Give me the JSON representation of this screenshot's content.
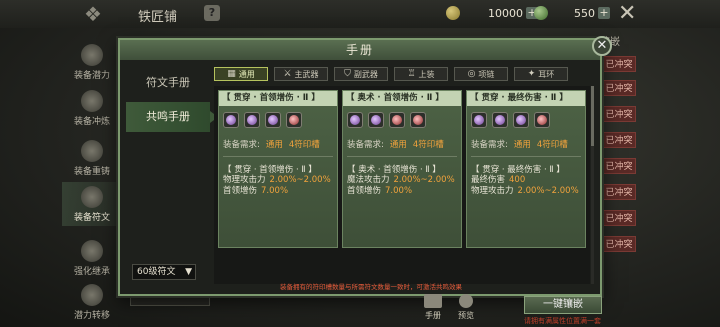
{
  "top": {
    "title": "铁匠铺",
    "resources": [
      {
        "icon": "gold-coin-icon",
        "value": "10000"
      },
      {
        "icon": "silver-coin-icon",
        "value": "550"
      }
    ]
  },
  "sidebar": {
    "items": [
      {
        "label": "装备潜力",
        "icon": "potential-icon"
      },
      {
        "label": "装备冲炼",
        "icon": "anvil-icon"
      },
      {
        "label": "装备重铸",
        "icon": "hammer-icon"
      },
      {
        "label": "装备符文",
        "icon": "rune-icon",
        "active": true
      },
      {
        "label": "强化继承",
        "icon": "inherit-icon"
      },
      {
        "label": "潜力转移",
        "icon": "transfer-icon"
      }
    ]
  },
  "right_col": {
    "tab_label": "镶嵌",
    "conflicts": [
      "已冲突",
      "已冲突",
      "已冲突",
      "已冲突",
      "已冲突",
      "已冲突",
      "已冲突",
      "已冲突"
    ]
  },
  "modal": {
    "title": "手册",
    "nav": [
      "符文手册",
      "共鸣手册"
    ],
    "active_nav": 1,
    "level_filter": "60级符文",
    "tabs": [
      {
        "label": "通用",
        "icon": "grid-icon",
        "active": true
      },
      {
        "label": "主武器",
        "icon": "sword-icon"
      },
      {
        "label": "副武器",
        "icon": "shield-icon"
      },
      {
        "label": "上装",
        "icon": "armor-icon"
      },
      {
        "label": "项链",
        "icon": "necklace-icon"
      },
      {
        "label": "耳环",
        "icon": "earring-icon"
      }
    ],
    "cards": [
      {
        "title": "【 贯穿 · 首领增伤 · Ⅱ 】",
        "gems": [
          "purple",
          "purple",
          "purple",
          "red"
        ],
        "req_label": "装备需求:",
        "req_type": "通用",
        "req_slots": "4符印槽",
        "effect_title": "【 贯穿 · 首领增伤 · Ⅱ 】",
        "effects": [
          {
            "name": "物理攻击力",
            "value": "2.00%~2.00%"
          },
          {
            "name": "首领增伤",
            "value": "7.00%"
          }
        ]
      },
      {
        "title": "【 奥术 · 首领增伤 · Ⅱ 】",
        "gems": [
          "purple",
          "purple",
          "red",
          "red"
        ],
        "req_label": "装备需求:",
        "req_type": "通用",
        "req_slots": "4符印槽",
        "effect_title": "【 奥术 · 首领增伤 · Ⅱ 】",
        "effects": [
          {
            "name": "魔法攻击力",
            "value": "2.00%~2.00%"
          },
          {
            "name": "首领增伤",
            "value": "7.00%"
          }
        ]
      },
      {
        "title": "【 贯穿 · 最终伤害 · Ⅱ 】",
        "gems": [
          "purple",
          "purple",
          "purple",
          "red"
        ],
        "req_label": "装备需求:",
        "req_type": "通用",
        "req_slots": "4符印槽",
        "effect_title": "【 贯穿 · 最终伤害 · Ⅱ 】",
        "effects": [
          {
            "name": "最终伤害",
            "value": "400"
          },
          {
            "name": "物理攻击力",
            "value": "2.00%~2.00%"
          }
        ]
      }
    ],
    "footnote": "装备拥有的符印槽数量与所需符文数量一致时，可激活共鸣效果"
  },
  "bottom": {
    "manual_label": "手册",
    "preview_label": "预览",
    "onekey_label": "一键镶嵌",
    "onekey_sub": "请拥有满属性位置满一套"
  }
}
